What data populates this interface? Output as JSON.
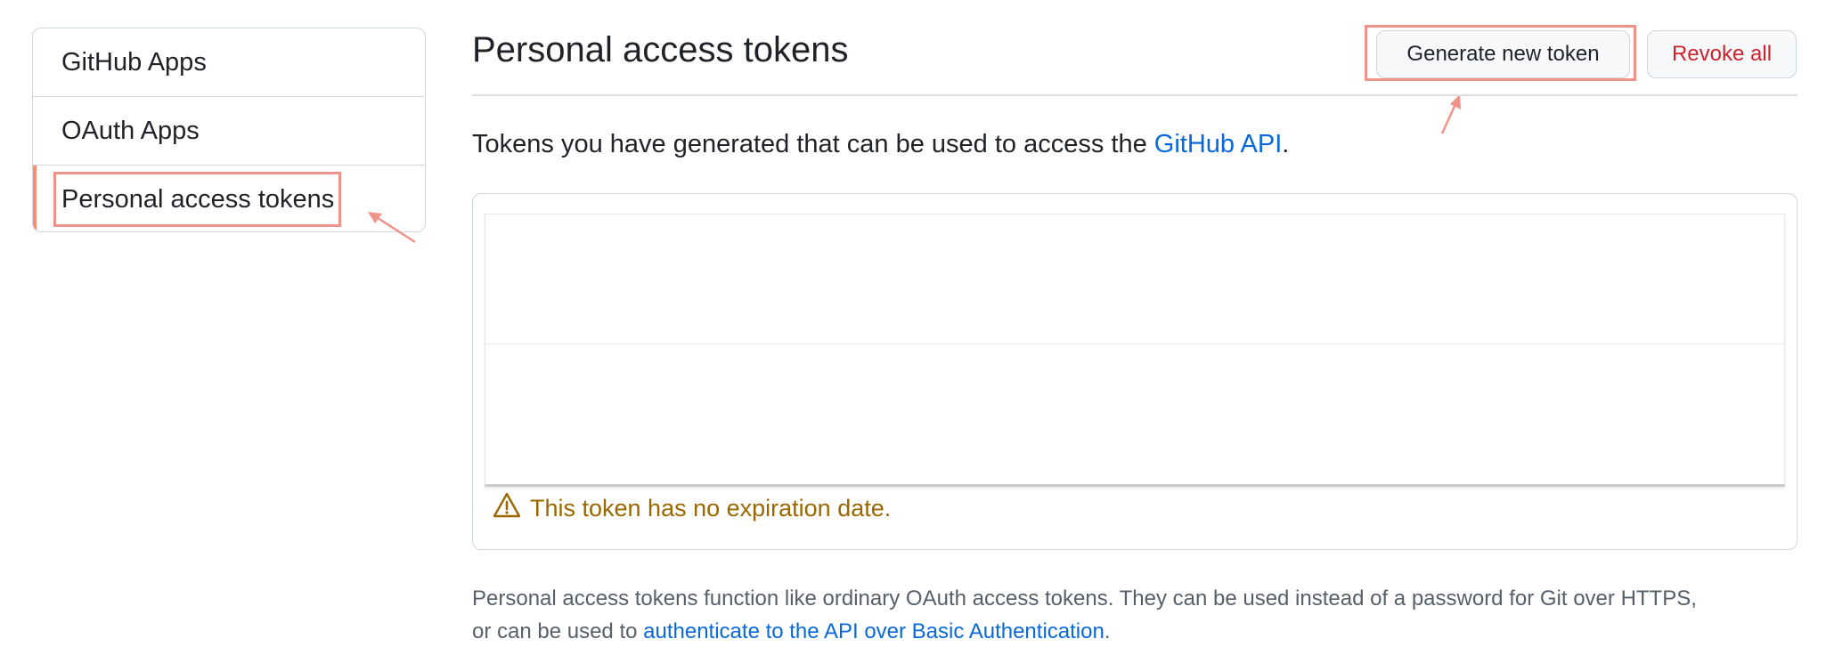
{
  "sidebar": {
    "items": [
      {
        "label": "GitHub Apps"
      },
      {
        "label": "OAuth Apps"
      },
      {
        "label": "Personal access tokens"
      }
    ]
  },
  "header": {
    "title": "Personal access tokens",
    "generate_label": "Generate new token",
    "revoke_label": "Revoke all"
  },
  "intro": {
    "text": "Tokens you have generated that can be used to access the ",
    "link": "GitHub API",
    "suffix": "."
  },
  "token": {
    "warning": "This token has no expiration date."
  },
  "footer": {
    "line1": "Personal access tokens function like ordinary OAuth access tokens. They can be used instead of a password for Git over HTTPS,",
    "prefix2": "or can be used to ",
    "link": "authenticate to the API over Basic Authentication",
    "suffix": "."
  },
  "colors": {
    "highlight": "#f0938a",
    "active_indicator": "#fd8c73",
    "link": "#0969da",
    "danger": "#cf222e",
    "warning": "#9a6700"
  },
  "icons": {
    "warning": "alert-triangle-icon"
  }
}
